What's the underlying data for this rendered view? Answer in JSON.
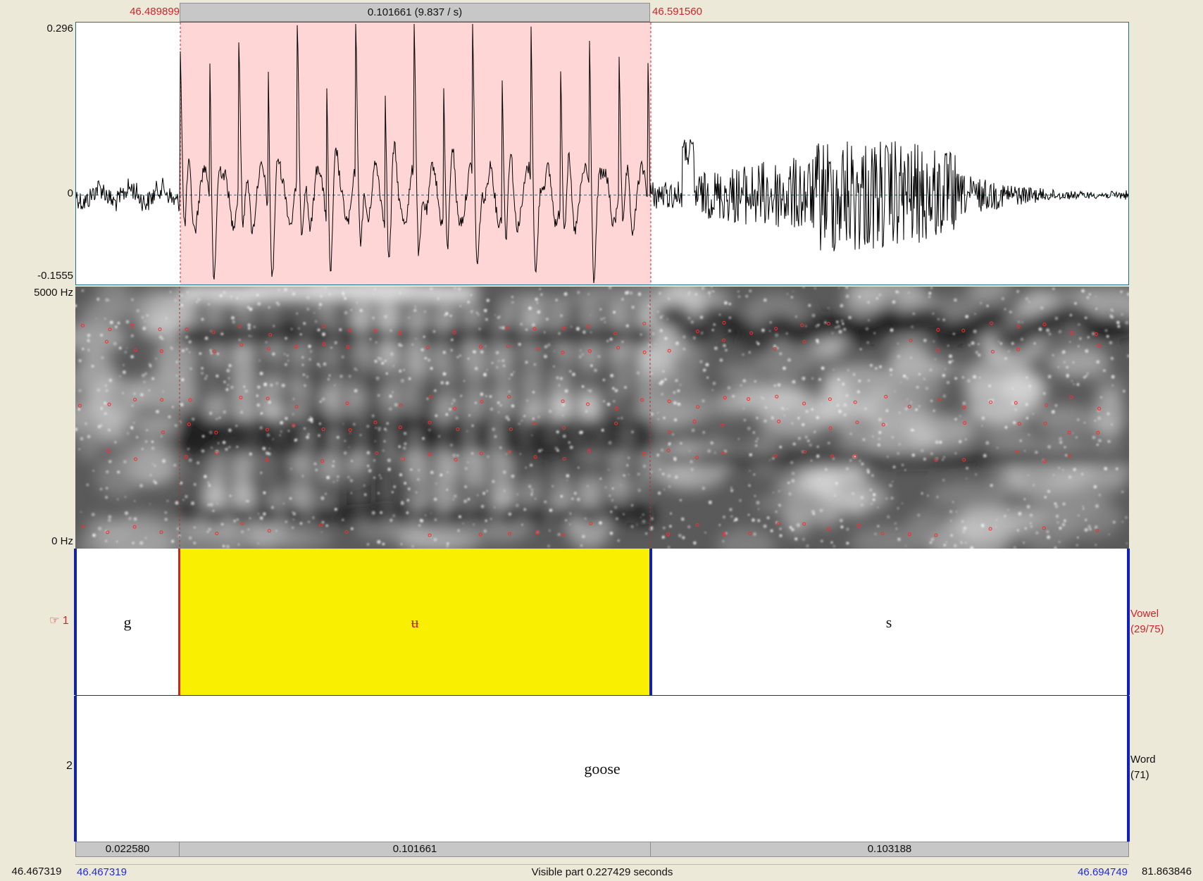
{
  "top_bar": {
    "left_time": "46.489899",
    "selection_label": "0.101661 (9.837 / s)",
    "right_time": "46.591560"
  },
  "waveform": {
    "y_max": "0.296",
    "y_zero": "0",
    "y_min": "-0.1555"
  },
  "spectrogram": {
    "freq_max": "5000 Hz",
    "freq_min": "0 Hz"
  },
  "tiers": [
    {
      "number": "1",
      "name": "Vowel",
      "count": "(29/75)",
      "intervals": [
        "g",
        "ʉ",
        "s"
      ]
    },
    {
      "number": "2",
      "name": "Word",
      "count": "(71)",
      "intervals": [
        "goose"
      ]
    }
  ],
  "duration_bar": [
    "0.022580",
    "0.101661",
    "0.103188"
  ],
  "bottom_bar": {
    "window_start": "46.467319",
    "visible_start": "46.467319",
    "visible_label": "Visible part 0.227429 seconds",
    "visible_end": "46.694749",
    "total_end": "81.863846"
  },
  "colors": {
    "selection_fill": "#ffd6d6",
    "selected_interval": "#f8f000",
    "boundary_blue": "#1120b8",
    "boundary_red": "#d1232b",
    "formant_dot": "#ff2a2a"
  },
  "icons": {
    "tier_pointer": "pointing-hand-icon"
  }
}
